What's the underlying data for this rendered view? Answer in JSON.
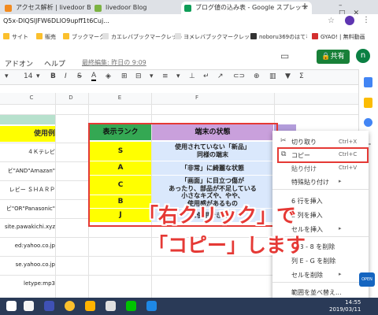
{
  "browser": {
    "tabs": [
      {
        "title": "アクセス解析 | livedoor Blog"
      },
      {
        "title": "livedoor Blog"
      },
      {
        "title": "ブログ値の込み表 - Google スプレッ"
      }
    ],
    "new_tab": "+",
    "url": "Q5x-DlQSlJFW6DLIO9upff1t6Cuj...",
    "bookmarks": [
      "サイト",
      "販売",
      "ブックマーク",
      "カエレバブックマークレット",
      "ヨメレバブックマークレット",
      "noboru369のはてな...",
      "GYAO! | 無料動画"
    ]
  },
  "sheets": {
    "menu": [
      "アドオン",
      "ヘルプ"
    ],
    "last_edit": "最終編集: 昨日の 9:09",
    "share_label": "共有",
    "avatar_letter": "n",
    "font_size": "14",
    "col_headers": [
      "C",
      "D",
      "E",
      "F"
    ],
    "col_a_title": "使用例",
    "col_a_cells": [
      "４Ｋテレビ",
      "ビ\"AND\"Amazan\"",
      "レビー ＳＨＡＲＰ",
      "ビ\"OR\"Panasonic\"",
      "site.pawakichi.xyz",
      "ed:yahoo.co.jp",
      "se.yahoo.co.jp",
      "letype:mp3"
    ]
  },
  "table": {
    "header_rank": "表示ランク",
    "header_state": "端末の状態",
    "rows": [
      {
        "rank": "S",
        "state1": "使用されていない「新品」",
        "state2": "同様の端末"
      },
      {
        "rank": "A",
        "state1": "「非常」に綺麗な状態",
        "state2": ""
      },
      {
        "rank": "C",
        "state1": "「画面」に目立つ傷が",
        "state2": "あったり、部品が不足している"
      },
      {
        "rank": "B",
        "state1": "小さなキズや、やや、",
        "state2": "使用感があるもの"
      },
      {
        "rank": "J",
        "state1": "",
        "state2": "に使用できない"
      }
    ]
  },
  "context_menu": {
    "items": [
      {
        "label": "切り取り",
        "shortcut": "Ctrl+X"
      },
      {
        "label": "コピー",
        "shortcut": "Ctrl+C"
      },
      {
        "label": "貼り付け",
        "shortcut": "Ctrl+V"
      },
      {
        "label": "特殊貼り付け",
        "shortcut": "▸"
      },
      {
        "label": "6 行を挿入",
        "shortcut": ""
      },
      {
        "label": "2 列を挿入",
        "shortcut": ""
      },
      {
        "label": "セルを挿入",
        "shortcut": "▸"
      },
      {
        "label": "行 3 - 8 を削除",
        "shortcut": ""
      },
      {
        "label": "列 E - G を削除",
        "shortcut": ""
      },
      {
        "label": "セルを削除",
        "shortcut": "▸"
      },
      {
        "label": "範囲を並べ替え...",
        "shortcut": ""
      }
    ]
  },
  "overlay": {
    "line1": "「右クリック」で",
    "line2": "「コピー」します"
  },
  "taskbar": {
    "time": "14:55",
    "date": "2019/03/11"
  },
  "colors": {
    "accent_red": "#e53935",
    "green": "#34a853",
    "purple": "#c9a0dc",
    "yellow": "#ffff00",
    "share_green": "#188038"
  }
}
